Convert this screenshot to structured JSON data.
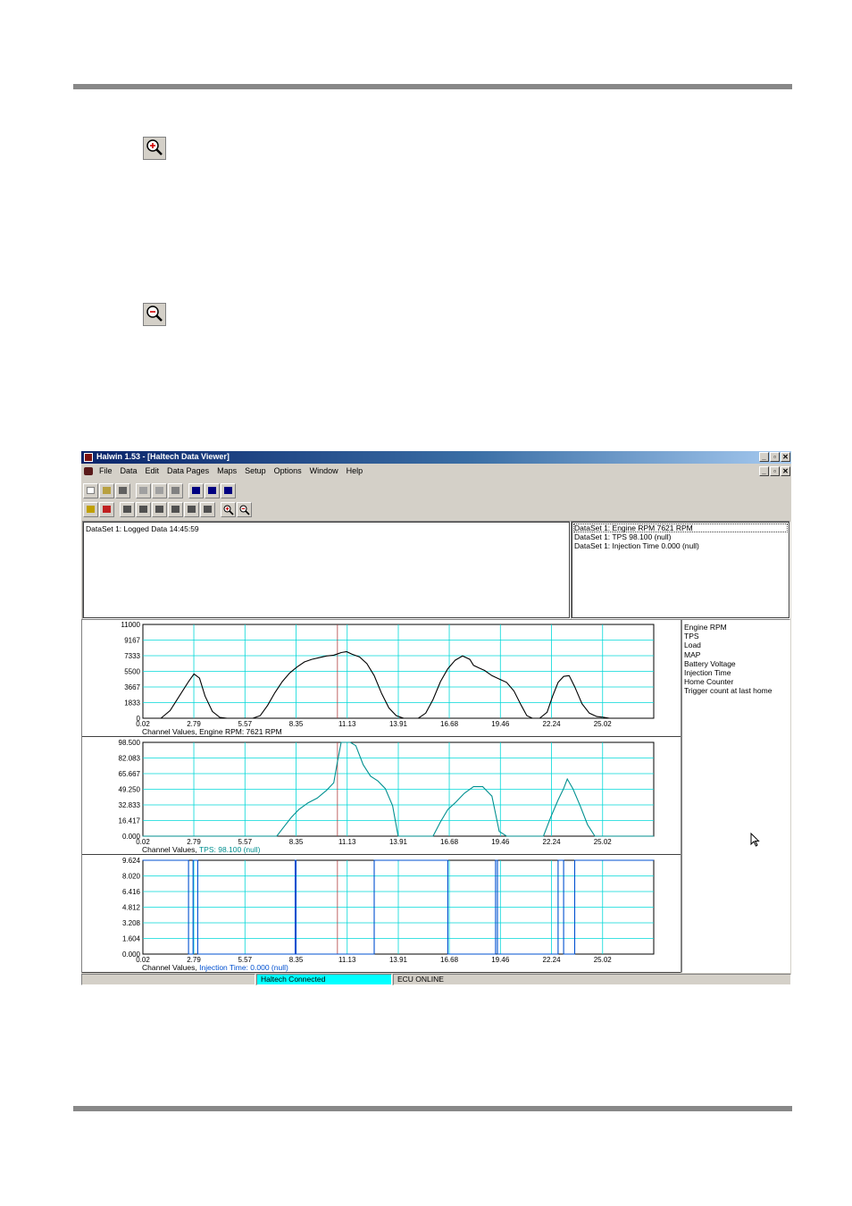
{
  "app": {
    "title": "Halwin 1.53 - [Haltech Data Viewer]",
    "menu": [
      "File",
      "Data",
      "Edit",
      "Data Pages",
      "Maps",
      "Setup",
      "Options",
      "Window",
      "Help"
    ]
  },
  "info": {
    "dataset_label": "DataSet 1: Logged Data 14:45:59",
    "values": [
      "DataSet 1: Engine RPM 7621 RPM",
      "DataSet 1: TPS 98.100 (null)",
      "DataSet 1: Injection Time 0.000 (null)"
    ]
  },
  "channels": [
    "Engine RPM",
    "TPS",
    "Load",
    "MAP",
    "Battery Voltage",
    "Injection Time",
    "Home Counter",
    "Trigger count at last home"
  ],
  "status": {
    "connection": "Haltech Connected",
    "ecu": "ECU ONLINE"
  },
  "colors": {
    "grid": "#00d8d8",
    "rpm_line": "#000000",
    "tps_line": "#008f8f",
    "inj_line": "#0050d0",
    "status_connected": "#00ffff",
    "cursor_line": "#b04040"
  },
  "chart_data": [
    {
      "type": "line",
      "caption_prefix": "Channel Values,",
      "caption_value": "Engine RPM: 7621 RPM",
      "x_ticks": [
        "0.02",
        "2.79",
        "5.57",
        "8.35",
        "11.13",
        "13.91",
        "16.68",
        "19.46",
        "22.24",
        "25.02"
      ],
      "y_ticks": [
        "11000",
        "9167",
        "7333",
        "5500",
        "3667",
        "1833",
        "0"
      ],
      "xlim": [
        0.02,
        27.8
      ],
      "ylim": [
        0,
        11000
      ],
      "x": [
        0.0,
        1.0,
        1.5,
        2.0,
        2.5,
        2.8,
        3.1,
        3.4,
        3.8,
        4.2,
        4.6,
        5.0,
        5.6,
        6.0,
        6.4,
        6.8,
        7.2,
        7.6,
        8.0,
        8.4,
        8.8,
        9.2,
        9.6,
        10.0,
        10.4,
        10.8,
        11.1,
        11.4,
        11.8,
        12.2,
        12.6,
        13.0,
        13.4,
        13.8,
        14.2,
        14.6,
        15.0,
        15.4,
        15.8,
        16.2,
        16.6,
        17.0,
        17.4,
        17.8,
        18.0,
        18.3,
        18.6,
        19.0,
        19.4,
        19.8,
        20.2,
        20.6,
        20.9,
        21.2,
        21.6,
        22.0,
        22.3,
        22.6,
        22.9,
        23.2,
        23.5,
        23.9,
        24.3,
        24.7,
        25.1,
        25.4,
        25.6
      ],
      "series": [
        {
          "values": [
            0,
            0,
            900,
            2600,
            4300,
            5200,
            4700,
            2600,
            800,
            100,
            0,
            0,
            0,
            0,
            300,
            1500,
            3000,
            4300,
            5300,
            6000,
            6600,
            6900,
            7100,
            7300,
            7400,
            7700,
            7800,
            7500,
            7200,
            6400,
            5000,
            2900,
            1200,
            300,
            0,
            0,
            0,
            600,
            2200,
            4300,
            5800,
            6800,
            7300,
            6900,
            6200,
            5900,
            5600,
            5000,
            4600,
            4200,
            3200,
            1500,
            300,
            0,
            0,
            700,
            2600,
            4200,
            4900,
            5000,
            3700,
            1700,
            600,
            200,
            100,
            0,
            0
          ]
        }
      ]
    },
    {
      "type": "line",
      "caption_prefix": "Channel Values,",
      "caption_value": "TPS: 98.100 (null)",
      "x_ticks": [
        "0.02",
        "2.79",
        "5.57",
        "8.35",
        "11.13",
        "13.91",
        "16.68",
        "19.46",
        "22.24",
        "25.02"
      ],
      "y_ticks": [
        "98.500",
        "82.083",
        "65.667",
        "49.250",
        "32.833",
        "16.417",
        "0.000"
      ],
      "xlim": [
        0.02,
        27.8
      ],
      "ylim": [
        0,
        98.5
      ],
      "x": [
        0.0,
        7.3,
        7.7,
        8.1,
        8.5,
        9.0,
        9.5,
        10.0,
        10.4,
        10.6,
        10.8,
        11.3,
        11.6,
        12.0,
        12.4,
        12.8,
        13.2,
        13.6,
        13.9,
        14.4,
        15.8,
        16.2,
        16.6,
        17.0,
        17.5,
        18.0,
        18.5,
        19.0,
        19.4,
        19.8,
        20.3,
        21.8,
        22.2,
        22.6,
        22.9,
        23.1,
        23.4,
        23.8,
        24.2,
        24.6,
        27.8
      ],
      "series": [
        {
          "values": [
            0,
            0,
            10,
            20,
            28,
            35,
            40,
            48,
            56,
            78,
            98.5,
            98.5,
            95,
            75,
            63,
            58,
            50,
            32,
            0,
            0,
            0,
            15,
            28,
            35,
            45,
            52,
            52,
            42,
            5,
            0,
            0,
            0,
            20,
            38,
            50,
            60,
            50,
            32,
            12,
            0,
            0
          ]
        }
      ]
    },
    {
      "type": "line",
      "caption_prefix": "Channel Values,",
      "caption_value": "Injection Time: 0.000 (null)",
      "x_ticks": [
        "0.02",
        "2.79",
        "5.57",
        "8.35",
        "11.13",
        "13.91",
        "16.68",
        "19.46",
        "22.24",
        "25.02"
      ],
      "y_ticks": [
        "9.624",
        "8.020",
        "6.416",
        "4.812",
        "3.208",
        "1.604",
        "0.000"
      ],
      "xlim": [
        0.02,
        27.8
      ],
      "ylim": [
        0,
        9.624
      ],
      "x": [
        0.0,
        2.5,
        2.5,
        2.75,
        2.75,
        3.0,
        3.0,
        8.3,
        8.3,
        8.35,
        8.35,
        12.6,
        12.6,
        16.6,
        16.6,
        19.2,
        19.2,
        19.3,
        19.3,
        22.6,
        22.6,
        22.9,
        22.9,
        23.5,
        23.5,
        27.8
      ],
      "series": [
        {
          "values": [
            9.624,
            9.624,
            0,
            0,
            9.624,
            9.624,
            0,
            0,
            9.624,
            9.624,
            0,
            0,
            9.624,
            9.624,
            0,
            0,
            9.624,
            9.624,
            0,
            0,
            9.624,
            9.624,
            0,
            0,
            9.624,
            9.624
          ]
        }
      ]
    }
  ]
}
